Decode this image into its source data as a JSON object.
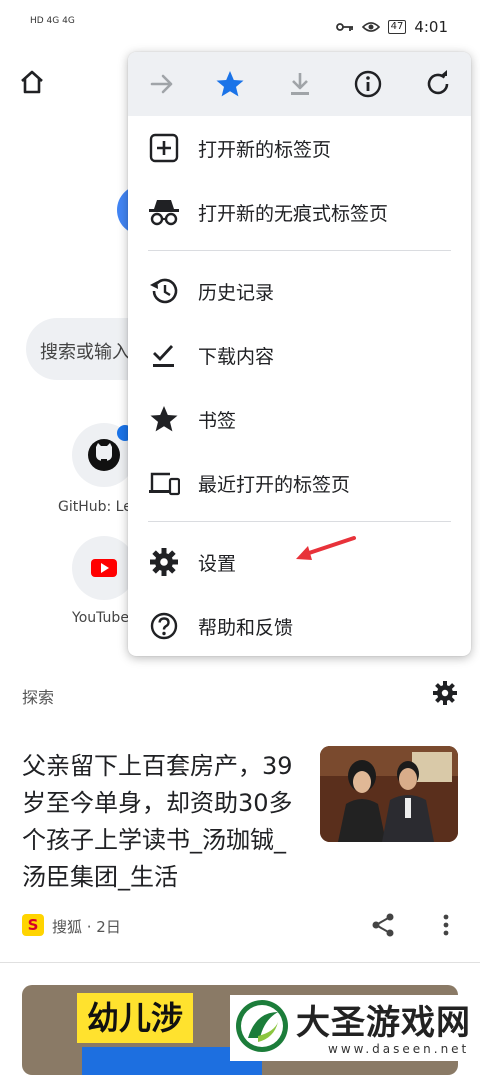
{
  "status_bar": {
    "left_text": "HD 4G 4G",
    "time": "4:01",
    "battery": "47"
  },
  "ntp": {
    "search_placeholder": "搜索或输入网址",
    "tiles": [
      {
        "label": "GitHub: Le"
      },
      {
        "label": "YouTube"
      }
    ],
    "explore_label": "探索"
  },
  "article": {
    "title": "父亲留下上百套房产，39岁至今单身，却资助30多个孩子上学读书_汤珈铖_汤臣集团_生活",
    "source_badge": "S",
    "source": "搜狐 · 2日"
  },
  "card2": {
    "banner_text": "幼儿涉"
  },
  "menu": {
    "toolbar": [
      {
        "icon": "forward-arrow-icon",
        "enabled": false
      },
      {
        "icon": "bookmark-star-icon",
        "enabled": true,
        "color": "#1a73e8"
      },
      {
        "icon": "download-icon",
        "enabled": false
      },
      {
        "icon": "info-icon",
        "enabled": true
      },
      {
        "icon": "refresh-icon",
        "enabled": true
      }
    ],
    "items": [
      {
        "label": "打开新的标签页",
        "icon": "new-tab-icon"
      },
      {
        "label": "打开新的无痕式标签页",
        "icon": "incognito-icon"
      },
      {
        "label": "历史记录",
        "icon": "history-icon"
      },
      {
        "label": "下载内容",
        "icon": "downloads-icon"
      },
      {
        "label": "书签",
        "icon": "bookmarks-icon"
      },
      {
        "label": "最近打开的标签页",
        "icon": "recent-tabs-icon"
      },
      {
        "label": "设置",
        "icon": "settings-icon"
      },
      {
        "label": "帮助和反馈",
        "icon": "help-icon"
      }
    ]
  },
  "watermark": {
    "title": "大圣游戏网",
    "url": "www.daseen.net"
  },
  "colors": {
    "accent": "#1a73e8",
    "arrow": "#e8323a",
    "toolbar_bg": "#eef0f3"
  }
}
